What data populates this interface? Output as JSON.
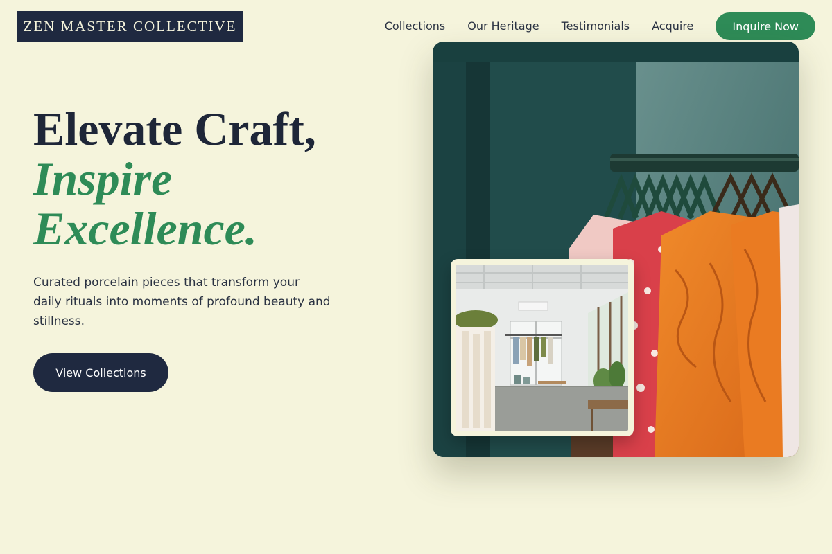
{
  "brand": {
    "name": "ZEN MASTER COLLECTIVE"
  },
  "nav": {
    "links": [
      "Collections",
      "Our Heritage",
      "Testimonials",
      "Acquire"
    ],
    "cta_label": "Inquire Now"
  },
  "hero": {
    "title_line1": "Elevate Craft,",
    "title_line2": "Inspire",
    "title_line3": "Excellence.",
    "subtitle": "Curated porcelain pieces that transform your daily rituals into moments of profound beauty and stillness.",
    "button_label": "View Collections"
  },
  "colors": {
    "background": "#f5f4dc",
    "navy": "#1f2940",
    "accent_green": "#2e8b57"
  },
  "images": {
    "main": "clothing-rack-photo",
    "inset": "boutique-interior-photo"
  }
}
